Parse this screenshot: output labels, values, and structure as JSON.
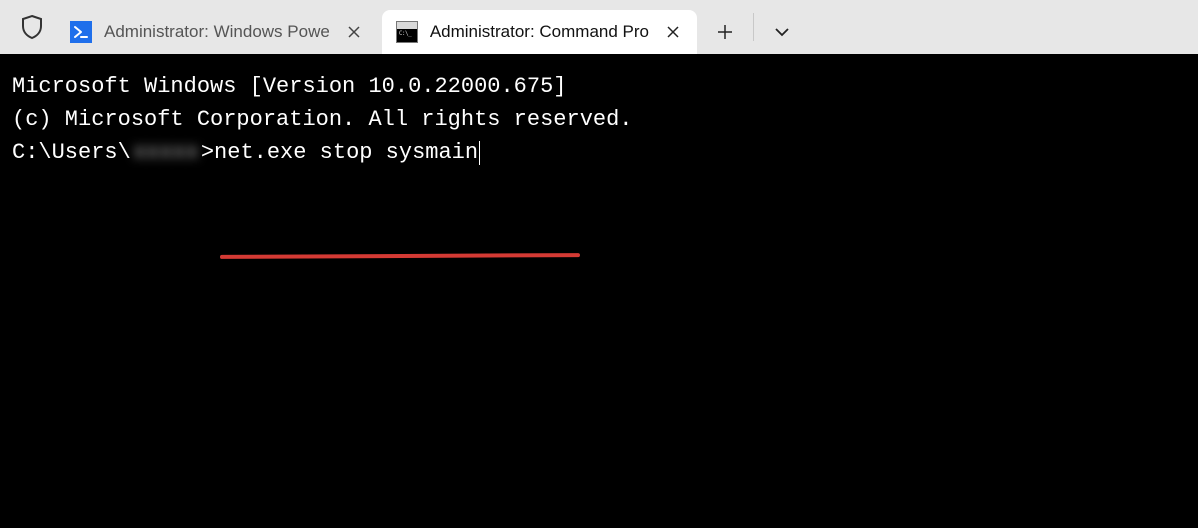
{
  "tabs": [
    {
      "title": "Administrator: Windows Powe",
      "icon": "powershell-icon",
      "active": false
    },
    {
      "title": "Administrator: Command Pro",
      "icon": "cmd-icon",
      "active": true
    }
  ],
  "terminal": {
    "line1": "Microsoft Windows [Version 10.0.22000.675]",
    "line2": "(c) Microsoft Corporation. All rights reserved.",
    "blank": "",
    "prompt_prefix": "C:\\Users\\",
    "prompt_user_obscured": "xxxxx",
    "prompt_sep": ">",
    "command": "net.exe stop sysmain"
  }
}
